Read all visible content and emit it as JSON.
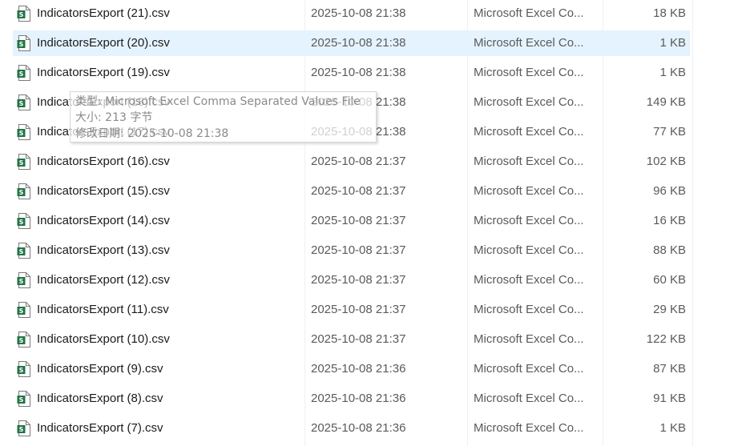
{
  "files": [
    {
      "name": "IndicatorsExport (21).csv",
      "date": "2025-10-08 21:38",
      "type": "Microsoft Excel Co...",
      "size": "18 KB",
      "selected": false
    },
    {
      "name": "IndicatorsExport (20).csv",
      "date": "2025-10-08 21:38",
      "type": "Microsoft Excel Co...",
      "size": "1 KB",
      "selected": true
    },
    {
      "name": "IndicatorsExport (19).csv",
      "date": "2025-10-08 21:38",
      "type": "Microsoft Excel Co...",
      "size": "1 KB",
      "selected": false
    },
    {
      "name": "IndicatorsExport (18).csv",
      "date": "2025-10-08 21:38",
      "type": "Microsoft Excel Co...",
      "size": "149 KB",
      "selected": false
    },
    {
      "name": "IndicatorsExport (17).csv",
      "date": "2025-10-08 21:38",
      "type": "Microsoft Excel Co...",
      "size": "77 KB",
      "selected": false
    },
    {
      "name": "IndicatorsExport (16).csv",
      "date": "2025-10-08 21:37",
      "type": "Microsoft Excel Co...",
      "size": "102 KB",
      "selected": false
    },
    {
      "name": "IndicatorsExport (15).csv",
      "date": "2025-10-08 21:37",
      "type": "Microsoft Excel Co...",
      "size": "96 KB",
      "selected": false
    },
    {
      "name": "IndicatorsExport (14).csv",
      "date": "2025-10-08 21:37",
      "type": "Microsoft Excel Co...",
      "size": "16 KB",
      "selected": false
    },
    {
      "name": "IndicatorsExport (13).csv",
      "date": "2025-10-08 21:37",
      "type": "Microsoft Excel Co...",
      "size": "88 KB",
      "selected": false
    },
    {
      "name": "IndicatorsExport (12).csv",
      "date": "2025-10-08 21:37",
      "type": "Microsoft Excel Co...",
      "size": "60 KB",
      "selected": false
    },
    {
      "name": "IndicatorsExport (11).csv",
      "date": "2025-10-08 21:37",
      "type": "Microsoft Excel Co...",
      "size": "29 KB",
      "selected": false
    },
    {
      "name": "IndicatorsExport (10).csv",
      "date": "2025-10-08 21:37",
      "type": "Microsoft Excel Co...",
      "size": "122 KB",
      "selected": false
    },
    {
      "name": "IndicatorsExport (9).csv",
      "date": "2025-10-08 21:36",
      "type": "Microsoft Excel Co...",
      "size": "87 KB",
      "selected": false
    },
    {
      "name": "IndicatorsExport (8).csv",
      "date": "2025-10-08 21:36",
      "type": "Microsoft Excel Co...",
      "size": "91 KB",
      "selected": false
    },
    {
      "name": "IndicatorsExport (7).csv",
      "date": "2025-10-08 21:36",
      "type": "Microsoft Excel Co...",
      "size": "1 KB",
      "selected": false
    }
  ],
  "tooltip": {
    "type_line": "类型: Microsoft Excel Comma Separated Values File",
    "size_line": "大小: 213 字节",
    "modified_line": "修改日期: 2025-10-08 21:38"
  },
  "colors": {
    "selection": "#e5f3ff",
    "csv_icon_accent": "#217346"
  },
  "icons": {
    "file": "csv-file-icon"
  }
}
